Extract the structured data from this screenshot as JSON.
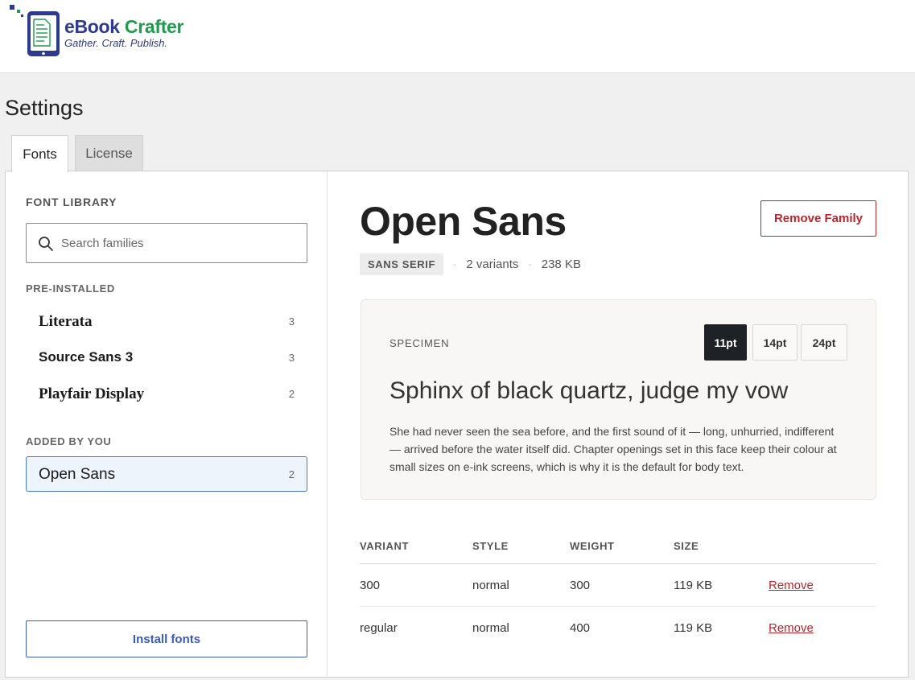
{
  "brand": {
    "name_part1": "eBook",
    "name_part2": "Crafter",
    "tagline": "Gather. Craft. Publish."
  },
  "page": {
    "title": "Settings"
  },
  "tabs": [
    {
      "label": "Fonts",
      "active": true
    },
    {
      "label": "License",
      "active": false
    }
  ],
  "sidebar": {
    "title": "FONT LIBRARY",
    "search_placeholder": "Search families",
    "preinstalled_label": "PRE-INSTALLED",
    "preinstalled": [
      {
        "name": "Literata",
        "count": "3"
      },
      {
        "name": "Source Sans 3",
        "count": "3"
      },
      {
        "name": "Playfair Display",
        "count": "2"
      }
    ],
    "added_label": "ADDED BY YOU",
    "added": [
      {
        "name": "Open Sans",
        "count": "2",
        "selected": true
      }
    ],
    "install_label": "Install fonts"
  },
  "detail": {
    "family": "Open Sans",
    "remove_family_label": "Remove Family",
    "category": "SANS SERIF",
    "variants_text": "2 variants",
    "size_text": "238 KB",
    "specimen": {
      "label": "SPECIMEN",
      "sizes": [
        "11pt",
        "14pt",
        "24pt"
      ],
      "active_size": "11pt",
      "heading": "Sphinx of black quartz, judge my vow",
      "body": "She had never seen the sea before, and the first sound of it — long, unhurried, indifferent — arrived before the water itself did. Chapter openings set in this face keep their colour at small sizes on e-ink screens, which is why it is the default for body text."
    },
    "table": {
      "headers": [
        "VARIANT",
        "STYLE",
        "WEIGHT",
        "SIZE"
      ],
      "rows": [
        {
          "variant": "300",
          "style": "normal",
          "weight": "300",
          "size": "119 KB",
          "action": "Remove"
        },
        {
          "variant": "regular",
          "style": "normal",
          "weight": "400",
          "size": "119 KB",
          "action": "Remove"
        }
      ]
    }
  },
  "colors": {
    "brand_blue": "#2e3a8c",
    "brand_green": "#1f9a4e",
    "danger": "#b8262c",
    "primary": "#3a5bb8",
    "selected_bg": "#eef4fc"
  }
}
